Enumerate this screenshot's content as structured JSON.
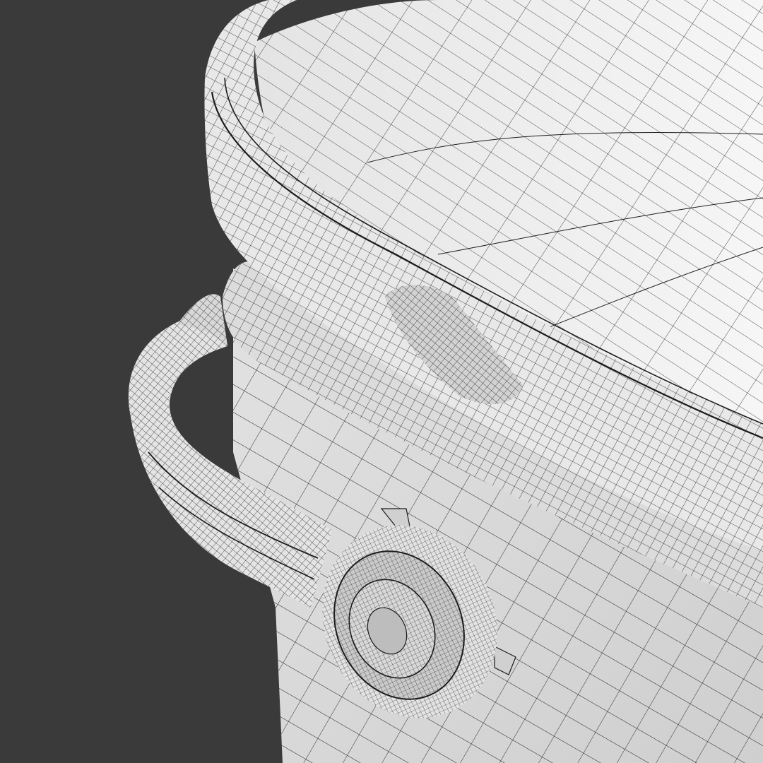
{
  "scene": {
    "subject": "bucket-wireframe-closeup",
    "colors": {
      "background": "#3a3a3a",
      "surface": "#ececec",
      "surface_shade": "#d6d6d6",
      "surface_dark": "#bdbdbd",
      "wire": "#1c1c1c"
    }
  }
}
